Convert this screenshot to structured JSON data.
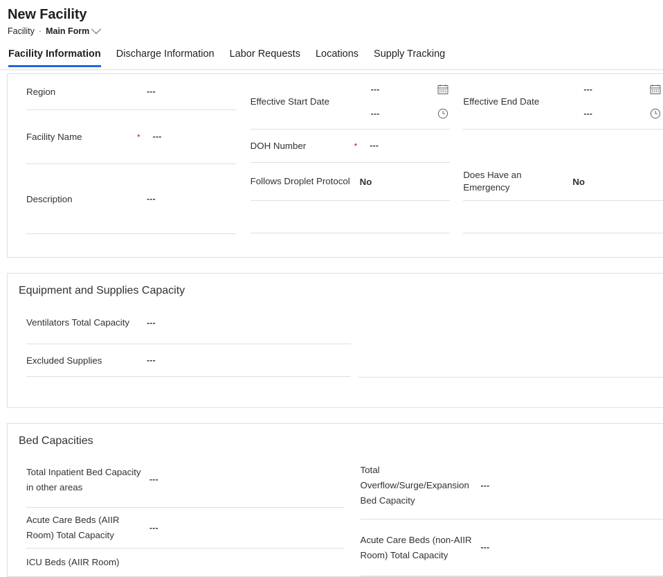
{
  "header": {
    "title": "New Facility",
    "entity": "Facility",
    "separator": "·",
    "form_name": "Main Form",
    "chevron_icon": "chevron-down-icon"
  },
  "tabs": [
    {
      "label": "Facility Information",
      "selected": true
    },
    {
      "label": "Discharge Information",
      "selected": false
    },
    {
      "label": "Labor Requests",
      "selected": false
    },
    {
      "label": "Locations",
      "selected": false
    },
    {
      "label": "Supply Tracking",
      "selected": false
    }
  ],
  "colors": {
    "accent": "#2266e3",
    "required": "#a4262c",
    "divider": "#e1dfdd",
    "text": "#323130"
  },
  "placeholder": "---",
  "sections": {
    "facility_info": {
      "column1": [
        {
          "label": "Region",
          "value": "---",
          "required": false
        },
        {
          "label": "Facility Name",
          "value": "---",
          "required": true
        },
        {
          "label": "Description",
          "value": "---",
          "required": false
        }
      ],
      "column2": [
        {
          "label": "Effective Start Date",
          "date_value": "---",
          "time_value": "---",
          "date_icon": "calendar-icon",
          "time_icon": "clock-icon",
          "required": false
        },
        {
          "label": "DOH Number",
          "value": "---",
          "required": true
        },
        {
          "label": "Follows Droplet Protocol",
          "value": "No",
          "required": false
        }
      ],
      "column3": [
        {
          "label": "Effective End Date",
          "date_value": "---",
          "time_value": "---",
          "date_icon": "calendar-icon",
          "time_icon": "clock-icon",
          "required": false
        },
        {
          "label": "Does Have an Emergency",
          "value": "No",
          "required": false
        }
      ]
    },
    "equipment": {
      "title": "Equipment and Supplies Capacity",
      "fields": [
        {
          "label": "Ventilators Total Capacity",
          "value": "---"
        },
        {
          "label": "Excluded Supplies",
          "value": "---"
        }
      ]
    },
    "bed_capacities": {
      "title": "Bed Capacities",
      "column1": [
        {
          "label": "Total Inpatient Bed Capacity in other areas",
          "value": "---"
        },
        {
          "label": "Acute Care Beds (AIIR Room) Total Capacity",
          "value": "---"
        },
        {
          "label": "ICU Beds (AIIR Room)",
          "value": ""
        }
      ],
      "column2": [
        {
          "label": "Total Overflow/Surge/Expansion Bed Capacity",
          "value": "---"
        },
        {
          "label": "Acute Care Beds (non-AIIR Room) Total Capacity",
          "value": "---"
        }
      ]
    }
  }
}
